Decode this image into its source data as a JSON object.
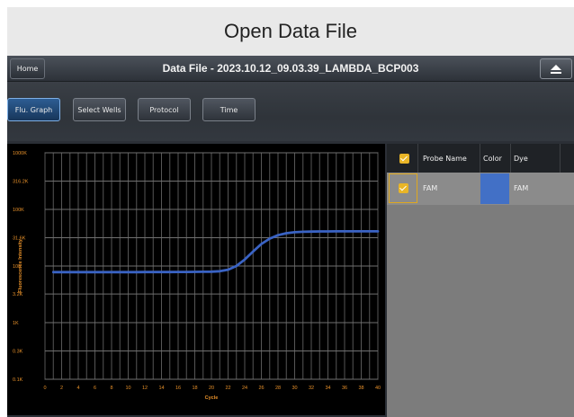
{
  "caption": "Open Data File",
  "window": {
    "title": "Data File - 2023.10.12_09.03.39_LAMBDA_BCP003",
    "home_label": "Home",
    "eject_icon": "eject-icon"
  },
  "tabs": [
    {
      "label": "Flu. Graph",
      "active": true
    },
    {
      "label": "Select Wells",
      "active": false
    },
    {
      "label": "Protocol",
      "active": false
    },
    {
      "label": "Time",
      "active": false
    }
  ],
  "chart_data": {
    "type": "line",
    "xlabel": "Cycle",
    "ylabel": "Fluorescence Intensity",
    "y_scale": "log",
    "xlim": [
      0,
      40
    ],
    "ylim": [
      100,
      1000000
    ],
    "x_ticks": [
      "0",
      "2",
      "4",
      "6",
      "8",
      "10",
      "12",
      "14",
      "16",
      "18",
      "20",
      "22",
      "24",
      "26",
      "28",
      "30",
      "32",
      "34",
      "36",
      "38",
      "40"
    ],
    "y_ticks": [
      {
        "label": "1000K",
        "value": 1000000
      },
      {
        "label": "316.2K",
        "value": 316200
      },
      {
        "label": "100K",
        "value": 100000
      },
      {
        "label": "31.6K",
        "value": 31600
      },
      {
        "label": "10K",
        "value": 10000
      },
      {
        "label": "3.2K",
        "value": 3200
      },
      {
        "label": "1K",
        "value": 1000
      },
      {
        "label": "0.3K",
        "value": 316
      },
      {
        "label": "0.1K",
        "value": 100
      }
    ],
    "grid": true,
    "colors": {
      "line": "#3a63c4",
      "grid": "#565656",
      "tick_label": "#e8912a",
      "bg": "#000000"
    },
    "series": [
      {
        "name": "FAM",
        "x": [
          1,
          2,
          3,
          4,
          5,
          6,
          7,
          8,
          9,
          10,
          11,
          12,
          13,
          14,
          15,
          16,
          17,
          18,
          19,
          20,
          21,
          22,
          23,
          24,
          25,
          26,
          27,
          28,
          29,
          30,
          31,
          32,
          33,
          34,
          35,
          36,
          37,
          38,
          39,
          40
        ],
        "y": [
          7800,
          7800,
          7800,
          7800,
          7800,
          7800,
          7800,
          7800,
          7800,
          7810,
          7810,
          7820,
          7820,
          7830,
          7840,
          7850,
          7860,
          7880,
          7900,
          7950,
          8100,
          8600,
          10000,
          13000,
          18000,
          24500,
          30500,
          35000,
          38000,
          39500,
          40200,
          40600,
          40800,
          40900,
          41000,
          41000,
          41000,
          41000,
          41000,
          41000
        ]
      }
    ]
  },
  "table": {
    "headers": [
      "Probe Name",
      "Color",
      "Dye"
    ],
    "rows": [
      {
        "probe": "FAM",
        "color": "#4270c6",
        "dye": "FAM",
        "checked": true
      }
    ]
  }
}
